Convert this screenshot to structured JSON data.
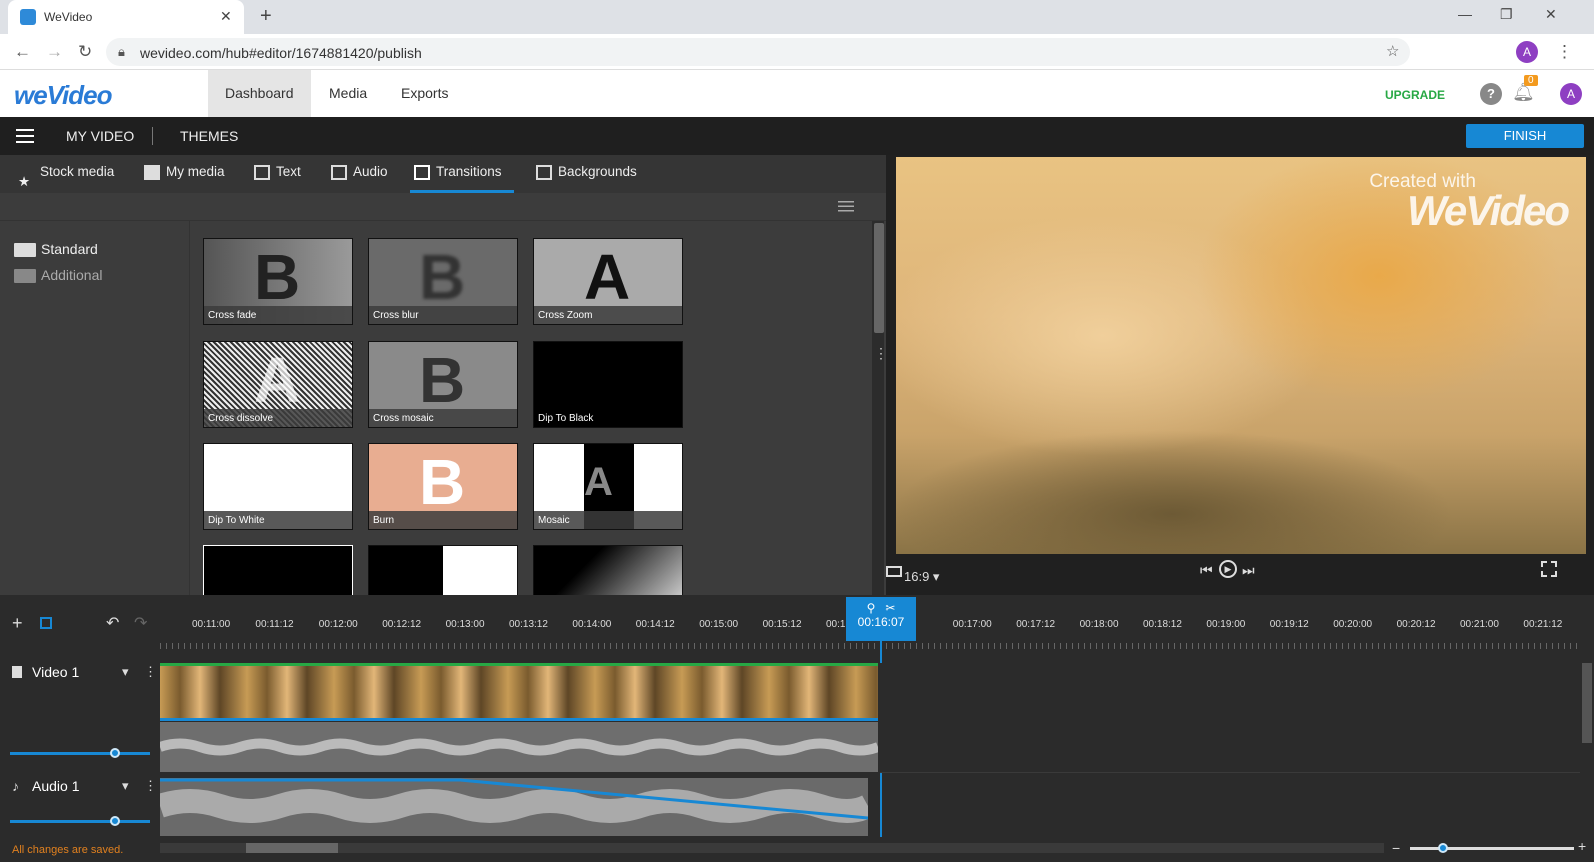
{
  "browser": {
    "tab_title": "WeVideo",
    "url": "wevideo.com/hub#editor/1674881420/publish"
  },
  "header": {
    "logo": "weVideo",
    "nav": [
      "Dashboard",
      "Media",
      "Exports"
    ],
    "upgrade": "UPGRADE",
    "notifications": "0",
    "avatar": "A"
  },
  "toolbar": {
    "my_video": "MY VIDEO",
    "themes": "THEMES",
    "finish": "FINISH"
  },
  "media_tabs": [
    "Stock media",
    "My media",
    "Text",
    "Audio",
    "Transitions",
    "Backgrounds"
  ],
  "categories": [
    "Standard",
    "Additional"
  ],
  "transitions": [
    {
      "label": "Cross fade",
      "letter": "B"
    },
    {
      "label": "Cross blur",
      "letter": "B"
    },
    {
      "label": "Cross Zoom",
      "letter": "A"
    },
    {
      "label": "Cross dissolve",
      "letter": "A"
    },
    {
      "label": "Cross mosaic",
      "letter": "B"
    },
    {
      "label": "Dip To Black",
      "letter": ""
    },
    {
      "label": "Dip To White",
      "letter": ""
    },
    {
      "label": "Burn",
      "letter": "B"
    },
    {
      "label": "Mosaic",
      "letter": "A"
    }
  ],
  "preview": {
    "watermark_small": "Created with",
    "watermark_big": "WeVideo",
    "aspect_ratio": "16:9"
  },
  "timeline": {
    "ticks": [
      "00:11:00",
      "00:11:12",
      "00:12:00",
      "00:12:12",
      "00:13:00",
      "00:13:12",
      "00:14:00",
      "00:14:12",
      "00:15:00",
      "00:15:12",
      "00:16",
      "12",
      "00:17:00",
      "00:17:12",
      "00:18:00",
      "00:18:12",
      "00:19:00",
      "00:19:12",
      "00:20:00",
      "00:20:12",
      "00:21:00",
      "00:21:12"
    ],
    "playhead": "00:16:07",
    "tracks": [
      {
        "name": "Video 1",
        "volume": 0.75
      },
      {
        "name": "Audio 1",
        "volume": 0.75
      }
    ],
    "status": "All changes are saved.",
    "zoom_level": 0.2
  }
}
